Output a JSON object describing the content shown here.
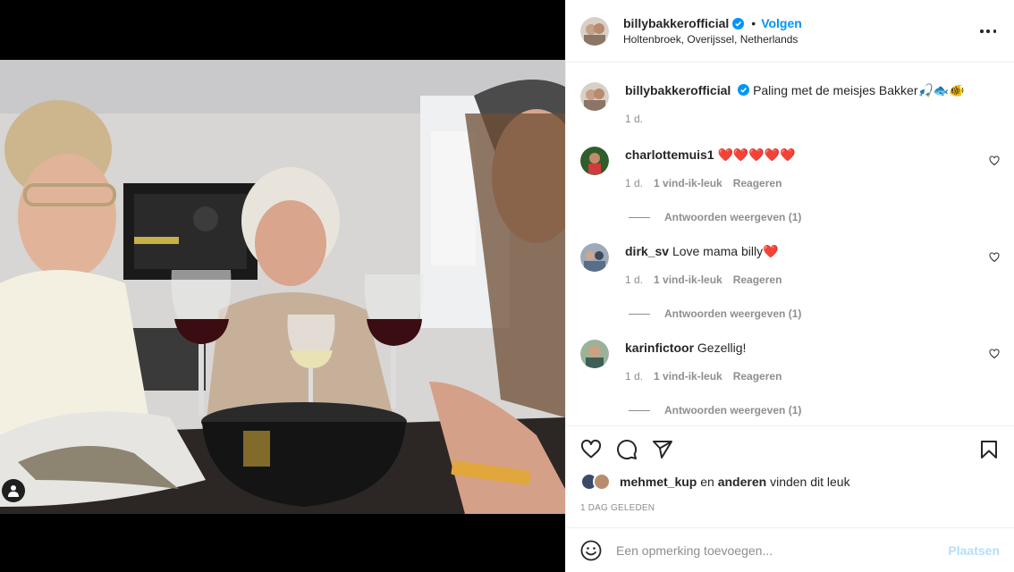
{
  "post": {
    "author": "billybakkerofficial",
    "follow_label": "Volgen",
    "location": "Holtenbroek, Overijssel, Netherlands",
    "caption": "Paling met de meisjes Bakker🎣🐟🐠",
    "caption_time": "1 d."
  },
  "comments": [
    {
      "user": "charlottemuis1",
      "text": "❤️❤️❤️❤️❤️",
      "time": "1 d.",
      "likes": "1 vind-ik-leuk",
      "reply_label": "Reageren",
      "view_replies": "Antwoorden weergeven (1)"
    },
    {
      "user": "dirk_sv",
      "text": "Love mama billy❤️",
      "time": "1 d.",
      "likes": "1 vind-ik-leuk",
      "reply_label": "Reageren",
      "view_replies": "Antwoorden weergeven (1)"
    },
    {
      "user": "karinfictoor",
      "text": "Gezellig!",
      "time": "1 d.",
      "likes": "1 vind-ik-leuk",
      "reply_label": "Reageren",
      "view_replies": "Antwoorden weergeven (1)"
    }
  ],
  "likes_line": {
    "first_liker": "mehmet_kup",
    "connector": "en",
    "others": "anderen",
    "suffix": "vinden dit leuk"
  },
  "posted_ago": "1 DAG GELEDEN",
  "add_comment": {
    "placeholder": "Een opmerking toevoegen...",
    "post_label": "Plaatsen"
  },
  "icons": [
    "verified-badge-icon",
    "more-options-icon",
    "heart-icon",
    "comment-icon",
    "share-icon",
    "bookmark-icon",
    "emoji-icon",
    "tagged-user-icon"
  ],
  "colors": {
    "accent": "#0095f6",
    "muted": "#8e8e8e",
    "text": "#262626",
    "post_disabled": "#b2dffc"
  }
}
